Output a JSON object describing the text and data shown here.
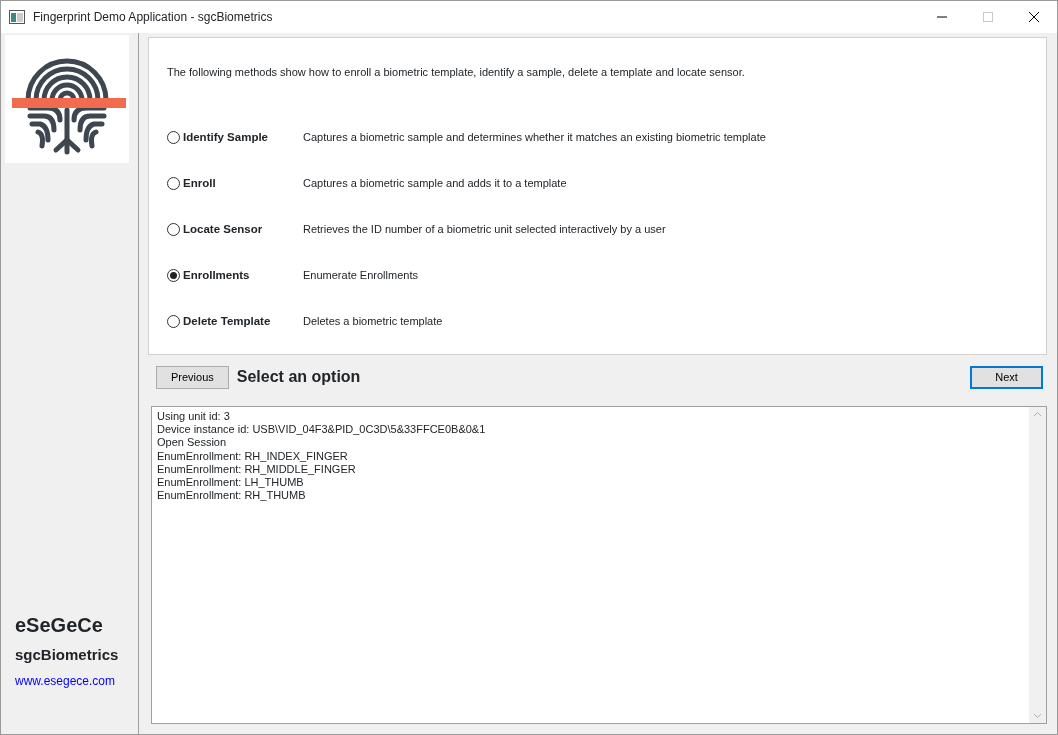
{
  "window": {
    "title": "Fingerprint Demo Application - sgcBiometrics",
    "maximize_disabled": true
  },
  "sidebar": {
    "company": "eSeGeCe",
    "product": "sgcBiometrics",
    "website": "www.esegece.com"
  },
  "intro": "The following methods show how to enroll a biometric template, identify a sample, delete a template and locate sensor.",
  "options": [
    {
      "label": "Identify Sample",
      "description": "Captures a biometric sample and determines whether it matches an existing biometric template",
      "selected": false
    },
    {
      "label": "Enroll",
      "description": "Captures a biometric sample and adds it to a template",
      "selected": false
    },
    {
      "label": "Locate Sensor",
      "description": "Retrieves the ID number of a biometric unit selected interactively by a user",
      "selected": false
    },
    {
      "label": "Enrollments",
      "description": "Enumerate Enrollments",
      "selected": true
    },
    {
      "label": "Delete Template",
      "description": "Deletes a biometric template",
      "selected": false
    }
  ],
  "nav": {
    "previous": "Previous",
    "heading": "Select an option",
    "next": "Next"
  },
  "log": [
    "Using unit id: 3",
    "Device instance id: USB\\VID_04F3&PID_0C3D\\5&33FFCE0B&0&1",
    "Open Session",
    "EnumEnrollment: RH_INDEX_FINGER",
    "EnumEnrollment: RH_MIDDLE_FINGER",
    "EnumEnrollment: LH_THUMB",
    "EnumEnrollment: RH_THUMB"
  ]
}
